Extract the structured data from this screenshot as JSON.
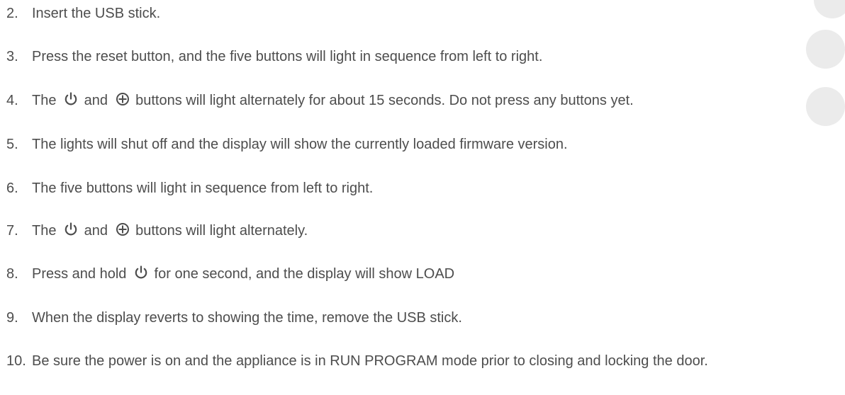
{
  "steps": [
    {
      "num": "2.",
      "text": "Insert the USB stick."
    },
    {
      "num": "3.",
      "text": "Press the reset button, and the five buttons will light in sequence from left to right."
    },
    {
      "num": "4.",
      "t1": "The",
      "t2": "and",
      "t3": "buttons will light alternately for about 15 seconds.  Do not press any buttons yet."
    },
    {
      "num": "5.",
      "text": "The lights will shut off and the display will show the currently loaded firmware version."
    },
    {
      "num": "6.",
      "text": "The five buttons will light in sequence from left to right."
    },
    {
      "num": "7.",
      "t1": "The",
      "t2": "and",
      "t3": "buttons will light alternately."
    },
    {
      "num": "8.",
      "t1": "Press and hold",
      "t2": "for one second, and the display will show LOAD"
    },
    {
      "num": "9.",
      "text": "When the display reverts to showing the time, remove the USB stick."
    },
    {
      "num": "10.",
      "text": "Be sure the power is on and the appliance is in RUN PROGRAM mode prior to closing and locking the door."
    }
  ],
  "icons": [
    "power-icon",
    "plus-circle-icon"
  ]
}
